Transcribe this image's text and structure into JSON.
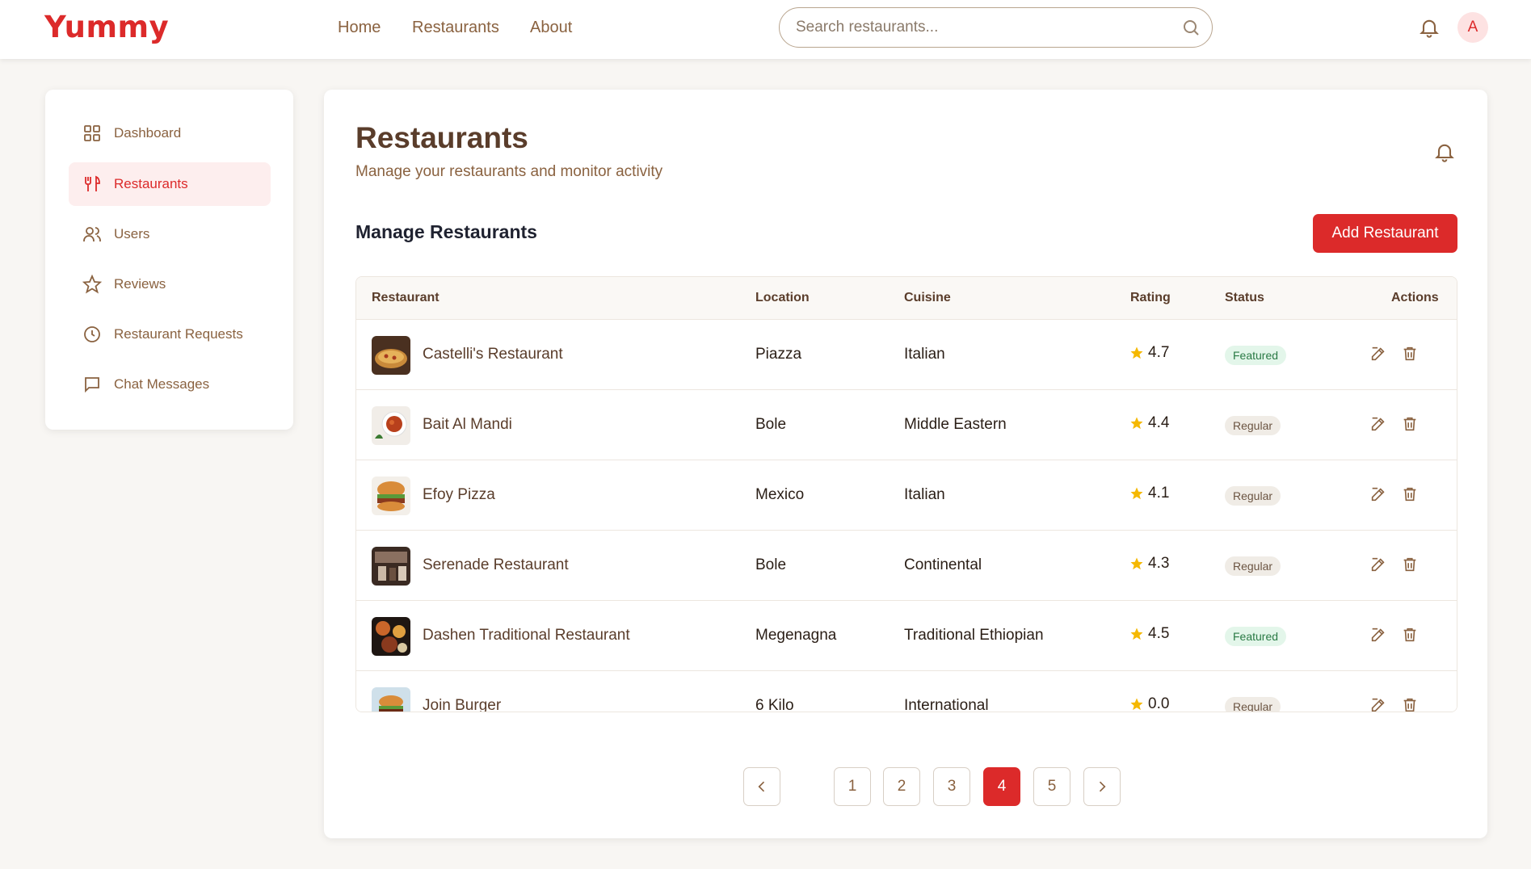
{
  "brand": {
    "logo_text": "Yummy",
    "accent": "#dc2a2a"
  },
  "topnav": {
    "links": [
      "Home",
      "Restaurants",
      "About"
    ],
    "search_placeholder": "Search restaurants...",
    "avatar_initial": "A"
  },
  "sidebar": {
    "items": [
      {
        "label": "Dashboard",
        "icon": "grid-icon",
        "active": false
      },
      {
        "label": "Restaurants",
        "icon": "utensils-icon",
        "active": true
      },
      {
        "label": "Users",
        "icon": "users-icon",
        "active": false
      },
      {
        "label": "Reviews",
        "icon": "star-icon",
        "active": false
      },
      {
        "label": "Restaurant Requests",
        "icon": "clock-icon",
        "active": false
      },
      {
        "label": "Chat Messages",
        "icon": "chat-icon",
        "active": false
      }
    ]
  },
  "main": {
    "title": "Restaurants",
    "subtitle": "Manage your restaurants and monitor activity",
    "section_title": "Manage Restaurants",
    "add_button": "Add Restaurant"
  },
  "table": {
    "headers": [
      "Restaurant",
      "Location",
      "Cuisine",
      "Rating",
      "Status",
      "Actions"
    ],
    "rows": [
      {
        "name": "Castelli's Restaurant",
        "location": "Piazza",
        "cuisine": "Italian",
        "rating": "4.7",
        "status": "Featured"
      },
      {
        "name": "Bait Al Mandi",
        "location": "Bole",
        "cuisine": "Middle Eastern",
        "rating": "4.4",
        "status": "Regular"
      },
      {
        "name": "Efoy Pizza",
        "location": "Mexico",
        "cuisine": "Italian",
        "rating": "4.1",
        "status": "Regular"
      },
      {
        "name": "Serenade Restaurant",
        "location": "Bole",
        "cuisine": "Continental",
        "rating": "4.3",
        "status": "Regular"
      },
      {
        "name": "Dashen Traditional Restaurant",
        "location": "Megenagna",
        "cuisine": "Traditional Ethiopian",
        "rating": "4.5",
        "status": "Featured"
      },
      {
        "name": "Join Burger",
        "location": "6 Kilo",
        "cuisine": "International",
        "rating": "0.0",
        "status": "Regular"
      }
    ]
  },
  "pagination": {
    "pages": [
      "1",
      "2",
      "3",
      "4",
      "5"
    ],
    "current": "4"
  }
}
